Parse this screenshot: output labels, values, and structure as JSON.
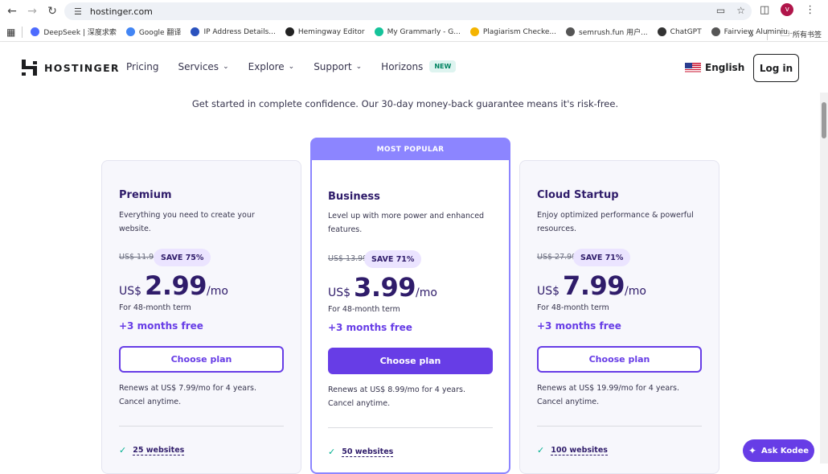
{
  "browser": {
    "url": "hostinger.com",
    "bookmarks": [
      {
        "label": "DeepSeek | 深度求索",
        "color": "#4d6bfe"
      },
      {
        "label": "Google 翻译",
        "color": "#4285f4"
      },
      {
        "label": "IP Address Details...",
        "color": "#2a52be"
      },
      {
        "label": "Hemingway Editor",
        "color": "#222222"
      },
      {
        "label": "My Grammarly - G...",
        "color": "#15c39a"
      },
      {
        "label": "Plagiarism Checke...",
        "color": "#f4b400"
      },
      {
        "label": "semrush.fun 用户...",
        "color": "#555555"
      },
      {
        "label": "ChatGPT",
        "color": "#333333"
      },
      {
        "label": "Fairview Aluminiu...",
        "color": "#555555"
      }
    ],
    "more_label": "»",
    "all_bookmarks_label": "所有书签",
    "avatar_letter": "v"
  },
  "header": {
    "logo_text": "HOSTINGER",
    "nav": {
      "pricing": "Pricing",
      "services": "Services",
      "explore": "Explore",
      "support": "Support",
      "horizons": "Horizons",
      "new_badge": "NEW"
    },
    "language": "English",
    "login": "Log in"
  },
  "tagline": "Get started in complete confidence. Our 30-day money-back guarantee means it's risk-free.",
  "popular_label": "MOST POPULAR",
  "plans": [
    {
      "name": "Premium",
      "description": "Everything you need to create your website.",
      "old_price": "US$ 11.99",
      "save": "SAVE 75%",
      "currency": "US$",
      "price": "2.99",
      "period": "/mo",
      "term": "For 48-month term",
      "free": "+3 months free",
      "button": "Choose plan",
      "renew": "Renews at US$ 7.99/mo for 4 years. Cancel anytime.",
      "feature": "25 websites"
    },
    {
      "name": "Business",
      "description": "Level up with more power and enhanced features.",
      "old_price": "US$ 13.99",
      "save": "SAVE 71%",
      "currency": "US$",
      "price": "3.99",
      "period": "/mo",
      "term": "For 48-month term",
      "free": "+3 months free",
      "button": "Choose plan",
      "renew": "Renews at US$ 8.99/mo for 4 years. Cancel anytime.",
      "feature": "50 websites"
    },
    {
      "name": "Cloud Startup",
      "description": "Enjoy optimized performance & powerful resources.",
      "old_price": "US$ 27.99",
      "save": "SAVE 71%",
      "currency": "US$",
      "price": "7.99",
      "period": "/mo",
      "term": "For 48-month term",
      "free": "+3 months free",
      "button": "Choose plan",
      "renew": "Renews at US$ 19.99/mo for 4 years. Cancel anytime.",
      "feature": "100 websites"
    }
  ],
  "ask_kodee": "Ask Kodee",
  "colors": {
    "brand_purple": "#673de6",
    "popular_purple": "#8c85ff",
    "dark_text": "#2f1c6a"
  }
}
